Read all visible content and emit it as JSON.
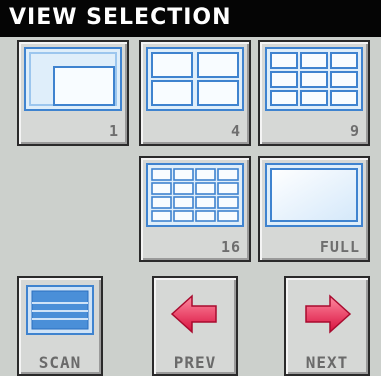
{
  "title": "VIEW SELECTION",
  "views": [
    {
      "label": "1",
      "icon": "single-view-icon"
    },
    {
      "label": "4",
      "icon": "quad-view-icon"
    },
    {
      "label": "9",
      "icon": "nine-view-icon"
    },
    {
      "label": "16",
      "icon": "sixteen-view-icon"
    },
    {
      "label": "FULL",
      "icon": "full-screen-icon"
    }
  ],
  "controls": {
    "scan": "SCAN",
    "prev": "PREV",
    "next": "NEXT"
  },
  "colors": {
    "accent_blue": "#4a8fd8",
    "arrow_red": "#e0204a"
  }
}
